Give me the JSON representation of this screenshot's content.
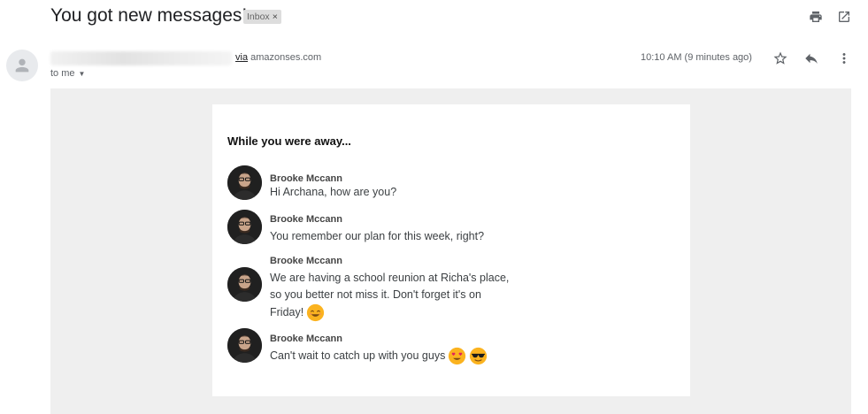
{
  "subject": "You got new messages!",
  "label": {
    "text": "Inbox",
    "remove": "×"
  },
  "toolbar": {
    "print_icon": "print-icon",
    "popout_icon": "open-in-new-window-icon"
  },
  "sender": {
    "via_word": "via",
    "domain": "amazonses.com",
    "recipient": "to me",
    "avatar_icon": "default-person-icon"
  },
  "time": "10:10 AM (9 minutes ago)",
  "actions": {
    "star_icon": "star-icon",
    "reply_icon": "reply-icon",
    "more_icon": "more-vert-icon"
  },
  "email_body": {
    "heading": "While you were away...",
    "messages": [
      {
        "name": "Brooke Mccann",
        "lines": [
          "Hi Archana, how are you?"
        ]
      },
      {
        "name": "Brooke Mccann",
        "lines": [
          "You remember our plan for this week, right?"
        ]
      },
      {
        "name": "Brooke Mccann",
        "lines": [
          "We are having a school reunion at Richa's place,",
          "so you better not miss it. Don't forget it's on",
          "Friday!"
        ]
      },
      {
        "name": "Brooke Mccann",
        "lines": [
          "Can't wait to catch up with you guys"
        ]
      }
    ]
  },
  "colors": {
    "panel_bg": "#efefef",
    "card_bg": "#ffffff",
    "label_bg": "#dddddd",
    "emoji_yellow": "#fbb31f",
    "heart_red": "#e0245e"
  }
}
